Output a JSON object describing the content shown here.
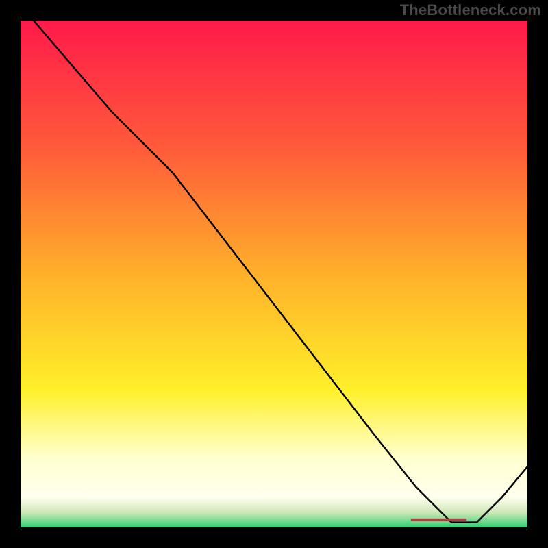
{
  "attribution": "TheBottleneck.com",
  "marker_label": "",
  "chart_data": {
    "type": "line",
    "title": "",
    "xlabel": "",
    "ylabel": "",
    "xlim": [
      0,
      100
    ],
    "ylim": [
      0,
      100
    ],
    "gradient_stops": [
      {
        "offset": 0,
        "color": "#ff1a4a"
      },
      {
        "offset": 25,
        "color": "#ff5a3a"
      },
      {
        "offset": 50,
        "color": "#ffb02a"
      },
      {
        "offset": 73,
        "color": "#fff02a"
      },
      {
        "offset": 86,
        "color": "#ffffcc"
      },
      {
        "offset": 94,
        "color": "#ffffee"
      },
      {
        "offset": 97,
        "color": "#cfe8b8"
      },
      {
        "offset": 100,
        "color": "#30d070"
      }
    ],
    "series": [
      {
        "name": "curve",
        "color": "#000000",
        "x": [
          0,
          6,
          12,
          18,
          24,
          30,
          40,
          50,
          60,
          70,
          78,
          85,
          90,
          95,
          100
        ],
        "y": [
          103,
          96,
          89,
          82,
          76,
          70,
          57,
          44,
          31,
          18,
          8,
          1,
          1,
          6,
          12
        ]
      }
    ],
    "marker": {
      "x_start": 77,
      "x_end": 88,
      "y": 1.5,
      "color": "#b04040"
    }
  }
}
